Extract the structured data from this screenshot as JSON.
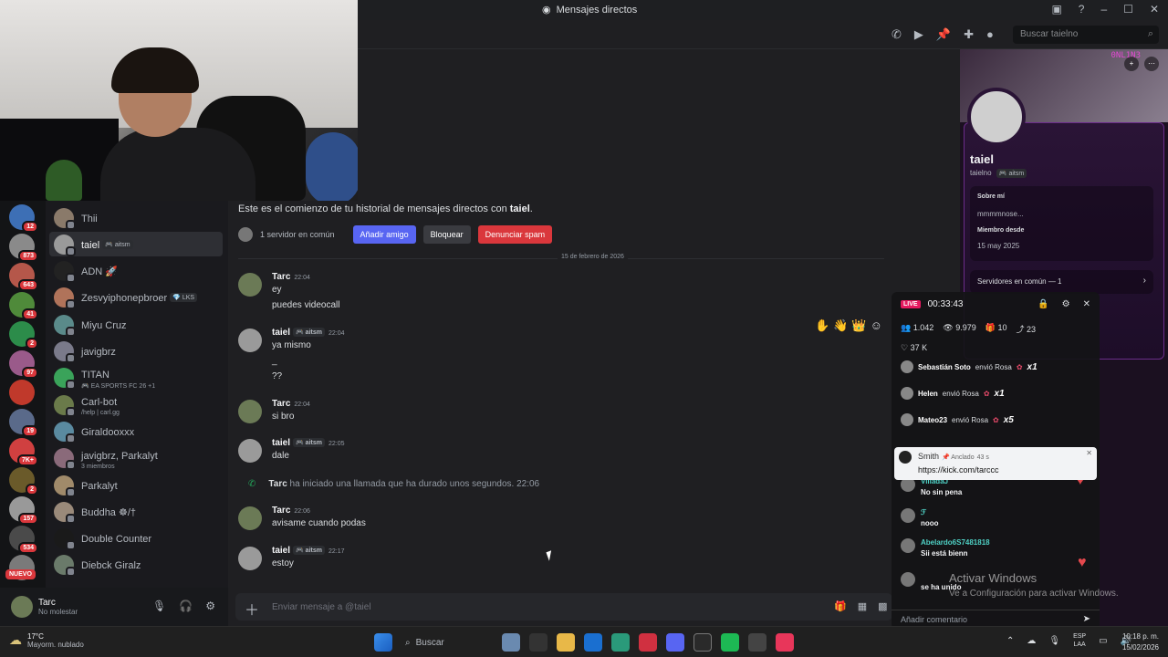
{
  "window": {
    "title": "Mensajes directos"
  },
  "header": {
    "search_placeholder": "Buscar taielno"
  },
  "servers": [
    {
      "color": "#3d6fb5",
      "badge": "12"
    },
    {
      "color": "#8a8a8a",
      "badge": "873"
    },
    {
      "color": "#b5574a",
      "badge": "643"
    },
    {
      "color": "#4f8a3a",
      "badge": "41"
    },
    {
      "color": "#2c8c4a",
      "badge": "2"
    },
    {
      "color": "#9a5a8a",
      "badge": "97"
    },
    {
      "color": "#c0392b",
      "badge": ""
    },
    {
      "color": "#5a6a8a",
      "badge": "19"
    },
    {
      "color": "#d04040",
      "badge": "7K+"
    },
    {
      "color": "#6a5a2a",
      "badge": "2"
    },
    {
      "color": "#999999",
      "badge": "157"
    },
    {
      "color": "#4a4a4a",
      "badge": "534"
    },
    {
      "color": "#7a7a7a",
      "badge": ""
    }
  ],
  "new_badge": "NUEVO",
  "dms": [
    {
      "name": "Thii",
      "color": "#8a7a6a"
    },
    {
      "name": "taiel",
      "tag": "🎮 aitsm",
      "color": "#9a9a9a"
    },
    {
      "name": "ADN 🚀",
      "color": "#222222"
    },
    {
      "name": "Zesvyiphonepbroer",
      "tag": "💎 LKS",
      "color": "#b0735a"
    },
    {
      "name": "Miyu Cruz",
      "color": "#5a8a8a"
    },
    {
      "name": "javigbrz",
      "color": "#7a7a8a"
    },
    {
      "name": "TITAN",
      "sub": "🎮 EA SPORTS FC 26 +1",
      "color": "#3aa35a"
    },
    {
      "name": "Carl-bot",
      "sub": "/help | carl.gg",
      "color": "#6a7a4a"
    },
    {
      "name": "Giraldooxxx",
      "color": "#5a8aa0"
    },
    {
      "name": "javigbrz, Parkalyt",
      "sub": "3 miembros",
      "color": "#8a6a7a"
    },
    {
      "name": "Parkalyt",
      "color": "#a08a6a"
    },
    {
      "name": "Buddha ☸/†",
      "color": "#9a8a7a"
    },
    {
      "name": "Double Counter",
      "color": "#1a1a1a"
    },
    {
      "name": "Diebck Giralz",
      "color": "#6a7a6a"
    }
  ],
  "user": {
    "name": "Tarc",
    "status": "No molestar"
  },
  "chat": {
    "intro_prefix": "Este es el comienzo de tu historial de mensajes directos con ",
    "intro_name": "taiel",
    "intro_suffix": ".",
    "common_servers": "1 servidor en común",
    "add_friend": "Añadir amigo",
    "block": "Bloquear",
    "report": "Denunciar spam",
    "date_divider": "15 de febrero de 2026",
    "messages": [
      {
        "author": "Tarc",
        "time": "22:04",
        "lines": [
          "ey",
          "puedes videocall"
        ],
        "color": "#6b7a56"
      },
      {
        "author": "taiel",
        "tag": "🎮 aitsm",
        "time": "22:04",
        "lines": [
          "ya mismo",
          "_",
          "??"
        ],
        "color": "#9a9a9a"
      },
      {
        "author": "Tarc",
        "time": "22:04",
        "lines": [
          "si bro"
        ],
        "color": "#6b7a56"
      },
      {
        "author": "taiel",
        "tag": "🎮 aitsm",
        "time": "22:05",
        "lines": [
          "dale"
        ],
        "color": "#9a9a9a"
      },
      {
        "author": "Tarc",
        "time": "22:06",
        "lines": [
          "avisame cuando podas"
        ],
        "color": "#6b7a56"
      },
      {
        "author": "taiel",
        "tag": "🎮 aitsm",
        "time": "22:17",
        "lines": [
          "estoy"
        ],
        "color": "#9a9a9a"
      }
    ],
    "call": {
      "author": "Tarc",
      "text": " ha iniciado una llamada que ha durado unos segundos. ",
      "time": "22:06"
    },
    "input_placeholder": "Enviar mensaje a @taiel"
  },
  "profile": {
    "name": "taiel",
    "username": "taielno",
    "tag": "🎮 aitsm",
    "neon_text": "0NL1N3",
    "about_label": "Sobre mí",
    "about_value": "mmmmnose...",
    "member_label": "Miembro desde",
    "member_value": "15 may 2025",
    "servers_label": "Servidores en común — 1"
  },
  "live": {
    "badge": "LIVE",
    "timer": "00:33:43",
    "stats": [
      "1.042",
      "9.979",
      "10",
      "23"
    ],
    "likes": "37 K",
    "gifts": [
      {
        "user": "Sebastián Soto",
        "verb": "envió Rosa",
        "mult": "x1"
      },
      {
        "user": "Helen",
        "verb": "envió Rosa",
        "mult": "x1"
      },
      {
        "user": "Mateo23",
        "verb": "envió Rosa",
        "mult": "x5"
      }
    ],
    "pinned": {
      "user": "Smith",
      "label": "📌 Anclado",
      "age": "43 s",
      "text": "https://kick.com/tarccc"
    },
    "comments": [
      {
        "user": "VilladaJ",
        "text": "No sin pena"
      },
      {
        "user": "ℱ",
        "text": "nooo"
      },
      {
        "user": "Abelardo6S7481818",
        "text": "Sii está bienn"
      },
      {
        "user": "",
        "text": "se ha unido"
      }
    ],
    "add_comment": "Añadir comentario"
  },
  "watermark": {
    "line1": "Activar Windows",
    "line2": "Ve a Configuración para activar Windows."
  },
  "taskbar": {
    "temp": "17°C",
    "weather": "Mayorm. nublado",
    "search": "Buscar",
    "lang1": "ESP",
    "lang2": "LAA",
    "time": "10:18 p. m.",
    "date": "15/02/2026"
  }
}
